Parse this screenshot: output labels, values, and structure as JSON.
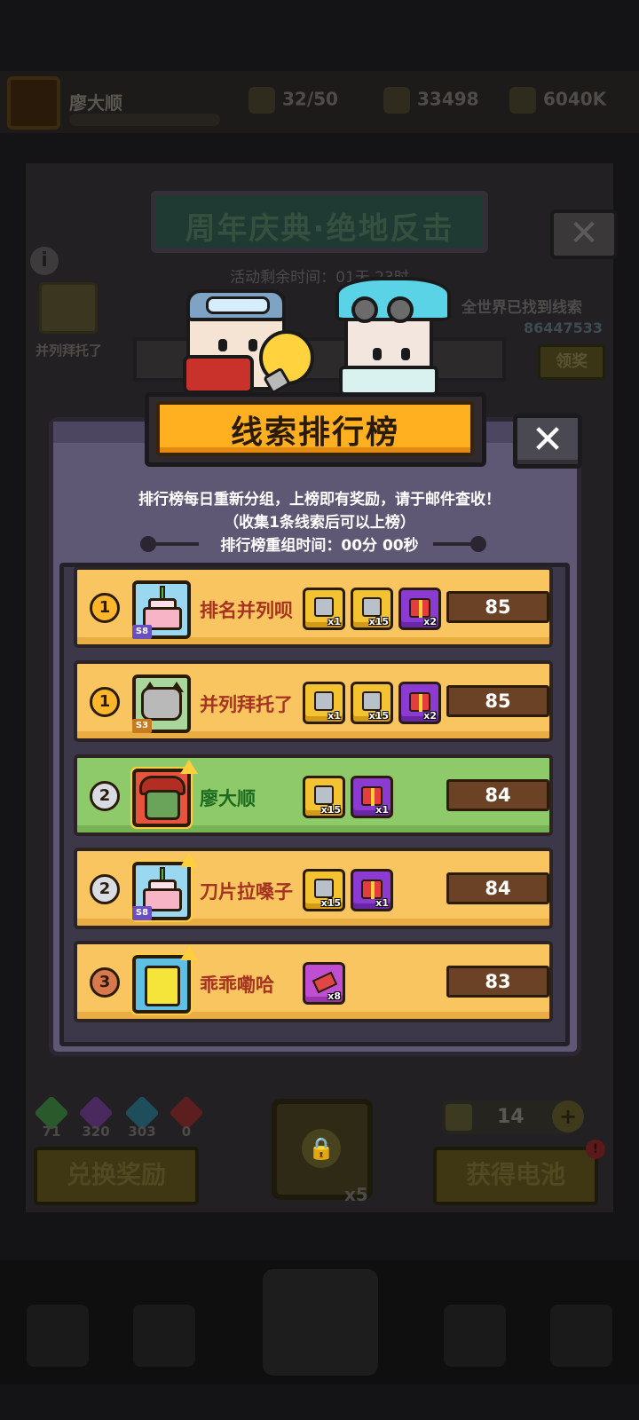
{
  "background": {
    "player_name": "廖大顺",
    "stats": [
      "32/50",
      "33498",
      "6040K"
    ],
    "event_title": "周年庆典·绝地反击",
    "event_timer": "活动剩余时间：01天 23时",
    "side_player_label": "并列拜托了",
    "global_label": "全世界已找到线索",
    "global_count": "86447533",
    "claim_button": "领奖",
    "info_icon": "i",
    "gems": [
      {
        "color": "#2a5a2c",
        "count": "71"
      },
      {
        "color": "#4a2a5e",
        "count": "320"
      },
      {
        "color": "#1e4d5c",
        "count": "303"
      },
      {
        "color": "#5c1e1e",
        "count": "0"
      }
    ],
    "exchange_button": "兑换奖励",
    "lock_multiplier": "x5",
    "battery_count": "14",
    "battery_plus": "+",
    "get_battery_button": "获得电池",
    "alert_mark": "!"
  },
  "modal": {
    "title": "线索排行榜",
    "close_symbol": "✕",
    "description_line1": "排行榜每日重新分组，上榜即有奖励，请于邮件查收！",
    "description_line2": "（收集1条线索后可以上榜）",
    "reset_time": "排行榜重组时间：00分 00秒",
    "ranking": [
      {
        "rank": "1",
        "medal": "gold",
        "name": "排名并列呗",
        "score": "85",
        "avatar": "cake",
        "season": "S8",
        "row_style": "yellow",
        "rewards": [
          {
            "type": "chest",
            "qty": "x1"
          },
          {
            "type": "chest",
            "qty": "x15"
          },
          {
            "type": "gift",
            "qty": "x2"
          }
        ]
      },
      {
        "rank": "1",
        "medal": "gold",
        "name": "并列拜托了",
        "score": "85",
        "avatar": "cat",
        "season": "S3",
        "row_style": "yellow",
        "rewards": [
          {
            "type": "chest",
            "qty": "x1"
          },
          {
            "type": "chest",
            "qty": "x15"
          },
          {
            "type": "gift",
            "qty": "x2"
          }
        ]
      },
      {
        "rank": "2",
        "medal": "silver",
        "name": "廖大顺",
        "score": "84",
        "avatar": "zombie",
        "season": "",
        "row_style": "green",
        "rewards": [
          {
            "type": "chest",
            "qty": "x15"
          },
          {
            "type": "gift",
            "qty": "x1"
          }
        ]
      },
      {
        "rank": "2",
        "medal": "silver",
        "name": "刀片拉嗓子",
        "score": "84",
        "avatar": "cake",
        "season": "S8",
        "row_style": "yellow",
        "rewards": [
          {
            "type": "chest",
            "qty": "x15"
          },
          {
            "type": "gift",
            "qty": "x1"
          }
        ]
      },
      {
        "rank": "3",
        "medal": "bronze",
        "name": "乖乖嘞哈",
        "score": "83",
        "avatar": "sponge",
        "season": "",
        "row_style": "yellow",
        "rewards": [
          {
            "type": "pink",
            "qty": "x8"
          }
        ]
      }
    ]
  }
}
